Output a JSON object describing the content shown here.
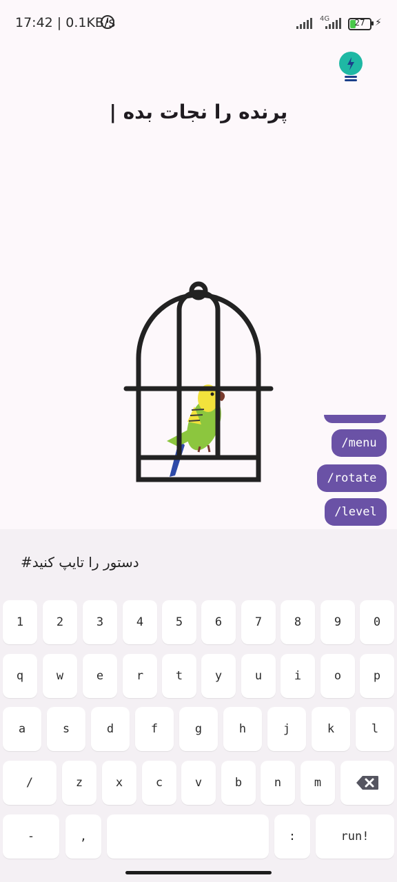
{
  "status_bar": {
    "time_speed": "17:42 | 0.1KB/s",
    "network": "4G",
    "battery": "27"
  },
  "game": {
    "title": "پرنده را نجات بده |"
  },
  "commands": [
    "/menu",
    "/rotate",
    "/level"
  ],
  "input": {
    "placeholder": "دستور را تایپ کنید#"
  },
  "keyboard": {
    "row1": [
      "1",
      "2",
      "3",
      "4",
      "5",
      "6",
      "7",
      "8",
      "9",
      "0"
    ],
    "row2": [
      "q",
      "w",
      "e",
      "r",
      "t",
      "y",
      "u",
      "i",
      "o",
      "p"
    ],
    "row3": [
      "a",
      "s",
      "d",
      "f",
      "g",
      "h",
      "j",
      "k",
      "l"
    ],
    "row4": [
      "/",
      "z",
      "x",
      "c",
      "v",
      "b",
      "n",
      "m"
    ],
    "row5": [
      "-",
      ",",
      ":",
      "run!"
    ]
  },
  "colors": {
    "chip": "#6a52a6",
    "bulb": "#1fb8a4",
    "parrot_body": "#8cc63e",
    "parrot_head": "#f2e23c"
  }
}
